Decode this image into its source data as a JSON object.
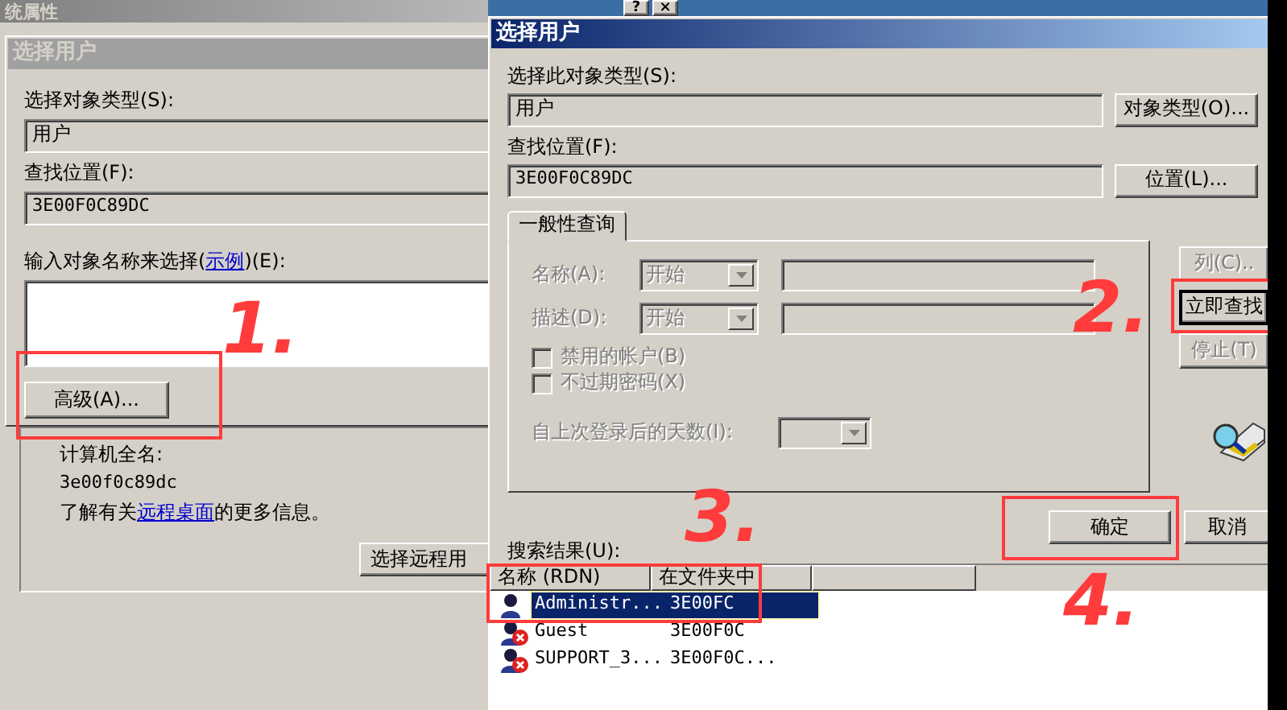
{
  "back_window": {
    "title": "统属性",
    "title_buttons": [
      "?",
      "×"
    ],
    "dialog": {
      "title": "选择用户",
      "object_type_label": "选择对象类型(S):",
      "object_type": "用户",
      "location_label": "查找位置(F):",
      "location": "3E00F0C89DC",
      "names_label": {
        "before": "输入对象名称来选择(",
        "link": "示例",
        "after": ")(E):"
      },
      "advanced_button": "高级(A)..."
    },
    "computer_name_label": "计算机全名:",
    "computer_name": "3e00f0c89dc",
    "remote_info": {
      "before": "了解有关",
      "link": "远程桌面",
      "after": "的更多信息。"
    },
    "select_remote_button": "选择远程用"
  },
  "dialog": {
    "title": "选择用户",
    "object_type_label": "选择此对象类型(S):",
    "object_type": "用户",
    "object_type_button": "对象类型(O)...",
    "location_label": "查找位置(F):",
    "location": "3E00F0C89DC",
    "location_button": "位置(L)...",
    "tabs": [
      {
        "label": "一般性查询",
        "selected": true
      }
    ],
    "query": {
      "disabled": true,
      "fields": [
        {
          "label": "名称(A):",
          "mode": "开始"
        },
        {
          "label": "描述(D):",
          "mode": "开始"
        }
      ],
      "checkboxes": [
        {
          "label": "禁用的帐户(B)",
          "checked": false
        },
        {
          "label": "不过期密码(X)",
          "checked": false
        }
      ],
      "days_label": "自上次登录后的天数(I):"
    },
    "side_buttons": [
      {
        "label": "列(C)..",
        "disabled": true,
        "focused": false
      },
      {
        "label": "立即查找",
        "disabled": false,
        "focused": true
      },
      {
        "label": "停止(T)",
        "disabled": true,
        "focused": false
      }
    ],
    "ok_button": "确定",
    "cancel_button": "取消",
    "results_label": "搜索结果(U):",
    "columns": [
      "名称 (RDN)",
      "在文件夹中"
    ],
    "rows": [
      {
        "name": "Administr...",
        "folder": "3E00FC",
        "account_disabled": false,
        "selected": true
      },
      {
        "name": "Guest",
        "folder": "3E00F0C",
        "account_disabled": true,
        "selected": false
      },
      {
        "name": "SUPPORT_3...",
        "folder": "3E00F0C...",
        "account_disabled": true,
        "selected": false
      }
    ]
  },
  "annotations": [
    {
      "label": "1."
    },
    {
      "label": "2."
    },
    {
      "label": "3."
    },
    {
      "label": "4."
    }
  ]
}
